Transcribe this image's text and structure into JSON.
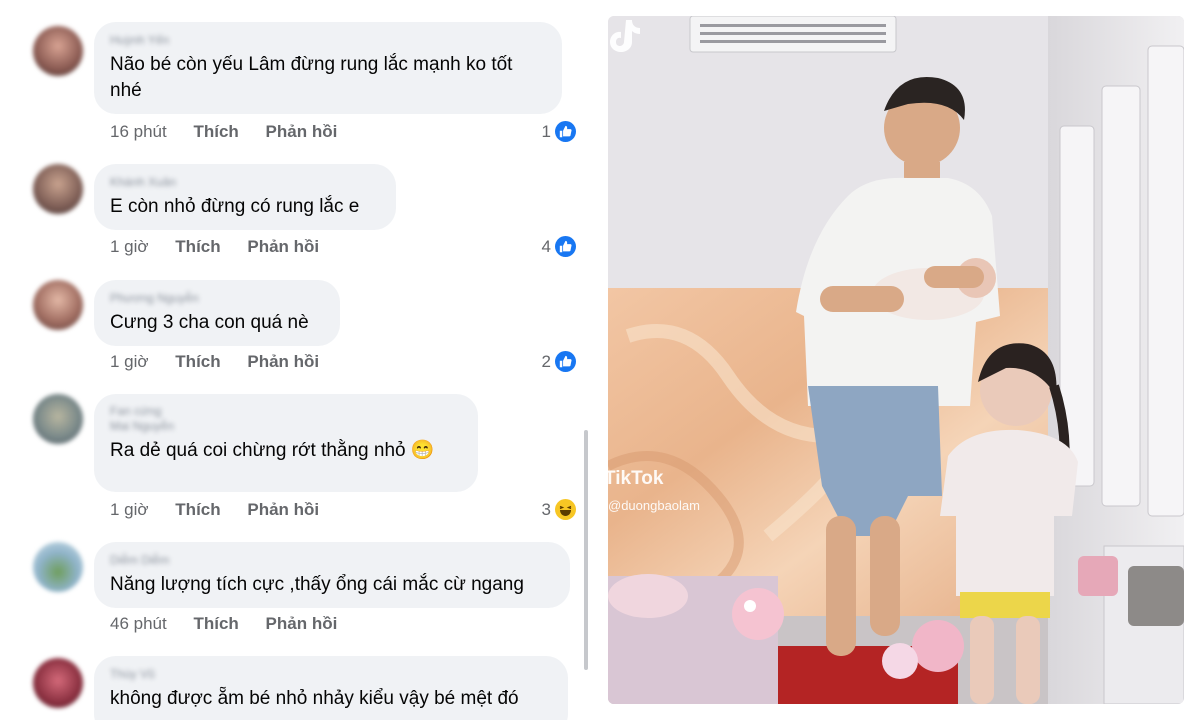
{
  "comments": [
    {
      "author": "Huỳnh Yến",
      "text": "Não bé còn yếu Lâm đừng rung lắc mạnh ko tốt nhé",
      "time": "16 phút",
      "like": "Thích",
      "reply": "Phản hồi",
      "reaction_count": "1",
      "reaction": "like-icon"
    },
    {
      "author": "Khánh Xuân",
      "text": "E còn nhỏ đừng có rung lắc e",
      "time": "1 giờ",
      "like": "Thích",
      "reply": "Phản hồi",
      "reaction_count": "4",
      "reaction": "like-icon"
    },
    {
      "author": "Phương Nguyễn",
      "text": "Cưng 3 cha con quá nè",
      "time": "1 giờ",
      "like": "Thích",
      "reply": "Phản hồi",
      "reaction_count": "2",
      "reaction": "like-icon"
    },
    {
      "badge": "Fan cứng",
      "author": "Mai Nguyễn",
      "text": "Ra dẻ quá coi chừng rớt thằng nhỏ 😁",
      "time": "1 giờ",
      "like": "Thích",
      "reply": "Phản hồi",
      "reaction_count": "3",
      "reaction": "haha-icon"
    },
    {
      "author": "Diễm Diễm",
      "text": "Năng lượng tích cực ,thấy ổng cái mắc cừ ngang",
      "time": "46 phút",
      "like": "Thích",
      "reply": "Phản hồi"
    },
    {
      "author": "Thùy Vũ",
      "text": "không được ẵm bé nhỏ nhảy kiểu vậy bé mệt đó"
    }
  ],
  "video": {
    "watermark_brand": "TikTok",
    "watermark_handle": "@duongbaolam"
  },
  "colors": {
    "like_blue": "#1877f2",
    "bubble_bg": "#f0f2f5",
    "meta_gray": "#65676b",
    "haha_yellow": "#f7c624"
  }
}
